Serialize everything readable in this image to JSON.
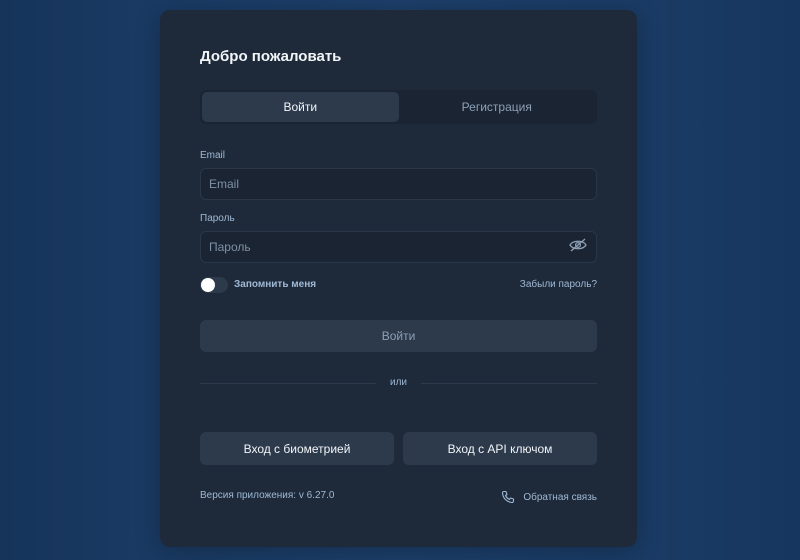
{
  "title": "Добро пожаловать",
  "tabs": [
    {
      "label": "Войти",
      "active": true
    },
    {
      "label": "Регистрация",
      "active": false
    }
  ],
  "email": {
    "label": "Email",
    "placeholder": "Email",
    "value": ""
  },
  "password": {
    "label": "Пароль",
    "placeholder": "Пароль",
    "value": "",
    "toggle_icon": "eye-off-icon"
  },
  "remember": {
    "label": "Запомнить меня",
    "checked": false
  },
  "forgot_label": "Забыли пароль?",
  "submit_label": "Войти",
  "divider_label": "или",
  "biometric_label": "Вход с биометрией",
  "api_key_label": "Вход с API ключом",
  "version_text": "Версия приложения: v 6.27.0",
  "feedback": {
    "label": "Обратная связь",
    "icon": "phone-icon"
  },
  "colors": {
    "background": "#1c3f6a",
    "card": "#1e2a3a",
    "input_bg": "#1a2433",
    "button_bg": "#2c3a4c",
    "muted_text": "#9fb8d4",
    "text": "#f2f5f8"
  }
}
